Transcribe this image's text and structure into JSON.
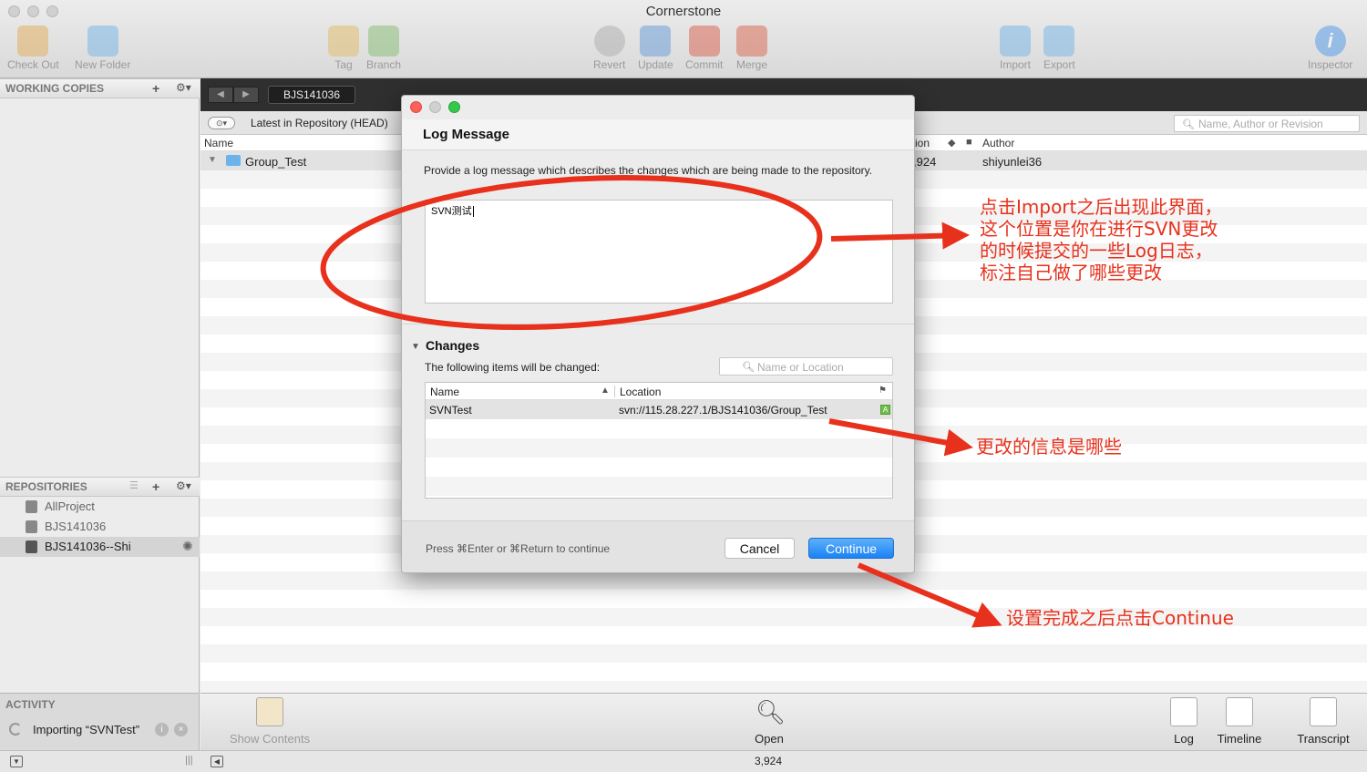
{
  "window": {
    "title": "Cornerstone"
  },
  "toolbar": {
    "check_out": "Check Out",
    "new_folder": "New Folder",
    "tag": "Tag",
    "branch": "Branch",
    "revert": "Revert",
    "update": "Update",
    "commit": "Commit",
    "merge": "Merge",
    "import": "Import",
    "export": "Export",
    "inspector": "Inspector"
  },
  "sidebar": {
    "working_copies": "WORKING COPIES",
    "repositories": "REPOSITORIES",
    "repos": [
      {
        "label": "AllProject"
      },
      {
        "label": "BJS141036"
      },
      {
        "label": "BJS141036--Shi",
        "selected": true
      }
    ],
    "activity": "ACTIVITY",
    "activity_job": "Importing “SVNTest”"
  },
  "main": {
    "crumb": "BJS141036",
    "revision_label": "Latest in Repository (HEAD)",
    "search_placeholder": "Name, Author or Revision",
    "columns": {
      "name": "Name",
      "revision_fragment": "ion",
      "author": "Author"
    },
    "row": {
      "name": "Group_Test",
      "revision_fragment": ",924",
      "author": "shiyunlei36"
    }
  },
  "bottom_bar": {
    "show_contents": "Show Contents",
    "open": "Open",
    "log": "Log",
    "timeline": "Timeline",
    "transcript": "Transcript",
    "count": "3,924"
  },
  "dialog": {
    "title": "Log Message",
    "description": "Provide a log message which describes the changes which are being made to the repository.",
    "message": "SVN测试",
    "changes_title": "Changes",
    "changes_desc": "The following items will be changed:",
    "changes_search_placeholder": "Name or Location",
    "table_headers": {
      "name": "Name",
      "location": "Location"
    },
    "items": [
      {
        "name": "SVNTest",
        "location": "svn://115.28.227.1/BJS141036/Group_Test",
        "status": "A"
      }
    ],
    "hint": "Press ⌘Enter or ⌘Return to continue",
    "cancel": "Cancel",
    "continue": "Continue"
  },
  "annotations": {
    "note1_line1": "点击Import之后出现此界面，",
    "note1_line2": "这个位置是你在进行SVN更改",
    "note1_line3": "的时候提交的一些Log日志，",
    "note1_line4": "标注自己做了哪些更改",
    "note2": "更改的信息是哪些",
    "note3": "设置完成之后点击Continue",
    "color": "#e8311c"
  }
}
